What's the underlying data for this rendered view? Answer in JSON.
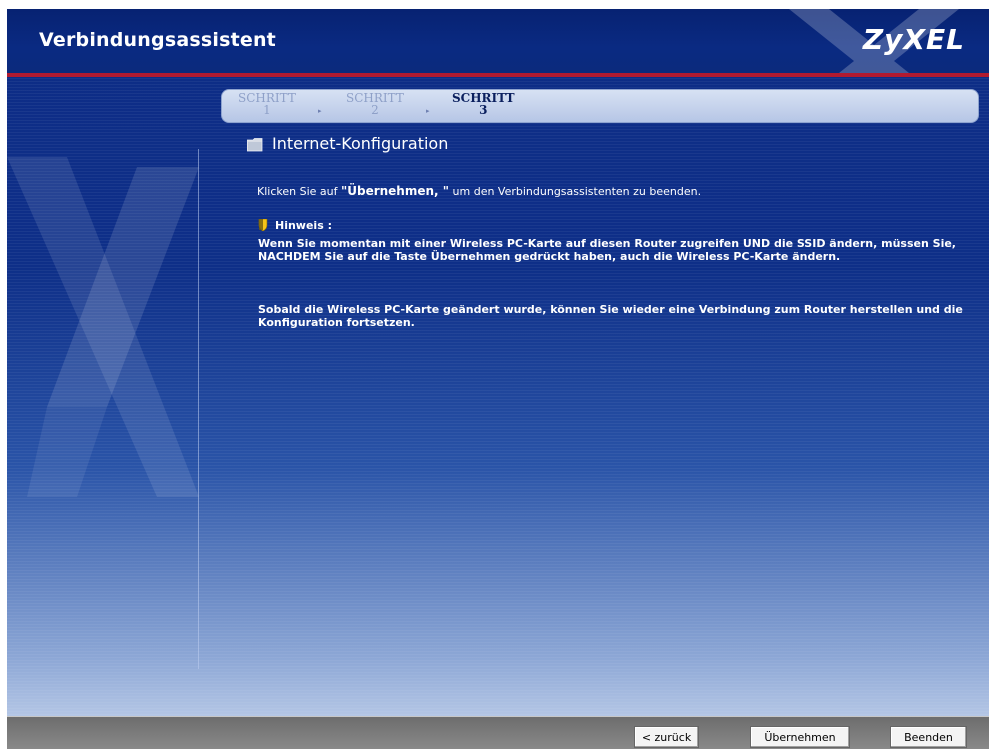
{
  "app": {
    "title": "Verbindungsassistent",
    "logo": "ZyXEL"
  },
  "steps": [
    {
      "label": "SCHRITT",
      "number": "1",
      "active": false
    },
    {
      "label": "SCHRITT",
      "number": "2",
      "active": false
    },
    {
      "label": "SCHRITT",
      "number": "3",
      "active": true
    }
  ],
  "section": {
    "title": "Internet-Konfiguration",
    "icon": "folder-icon"
  },
  "content": {
    "intro_prefix": "Klicken Sie auf ",
    "intro_bold": "\"Übernehmen, \"",
    "intro_suffix": " um den Verbindungsassistenten zu beenden.",
    "hint_label": "Hinweis :",
    "hint_icon": "shield-hint-icon",
    "hint_p1": "Wenn Sie momentan mit einer Wireless PC-Karte auf diesen Router zugreifen UND die SSID ändern, müssen Sie, NACHDEM Sie auf die Taste Übernehmen gedrückt haben, auch die Wireless PC-Karte ändern.",
    "hint_p2": "Sobald die Wireless PC-Karte geändert wurde, können Sie wieder eine Verbindung zum Router herstellen und die Konfiguration fortsetzen."
  },
  "buttons": {
    "back": "< zurück",
    "apply": "Übernehmen",
    "finish": "Beenden"
  },
  "colors": {
    "header": "#0a2a82",
    "accent_line": "#b11a30",
    "background_top": "#0d2c86",
    "background_bottom": "#c9d7ee"
  }
}
